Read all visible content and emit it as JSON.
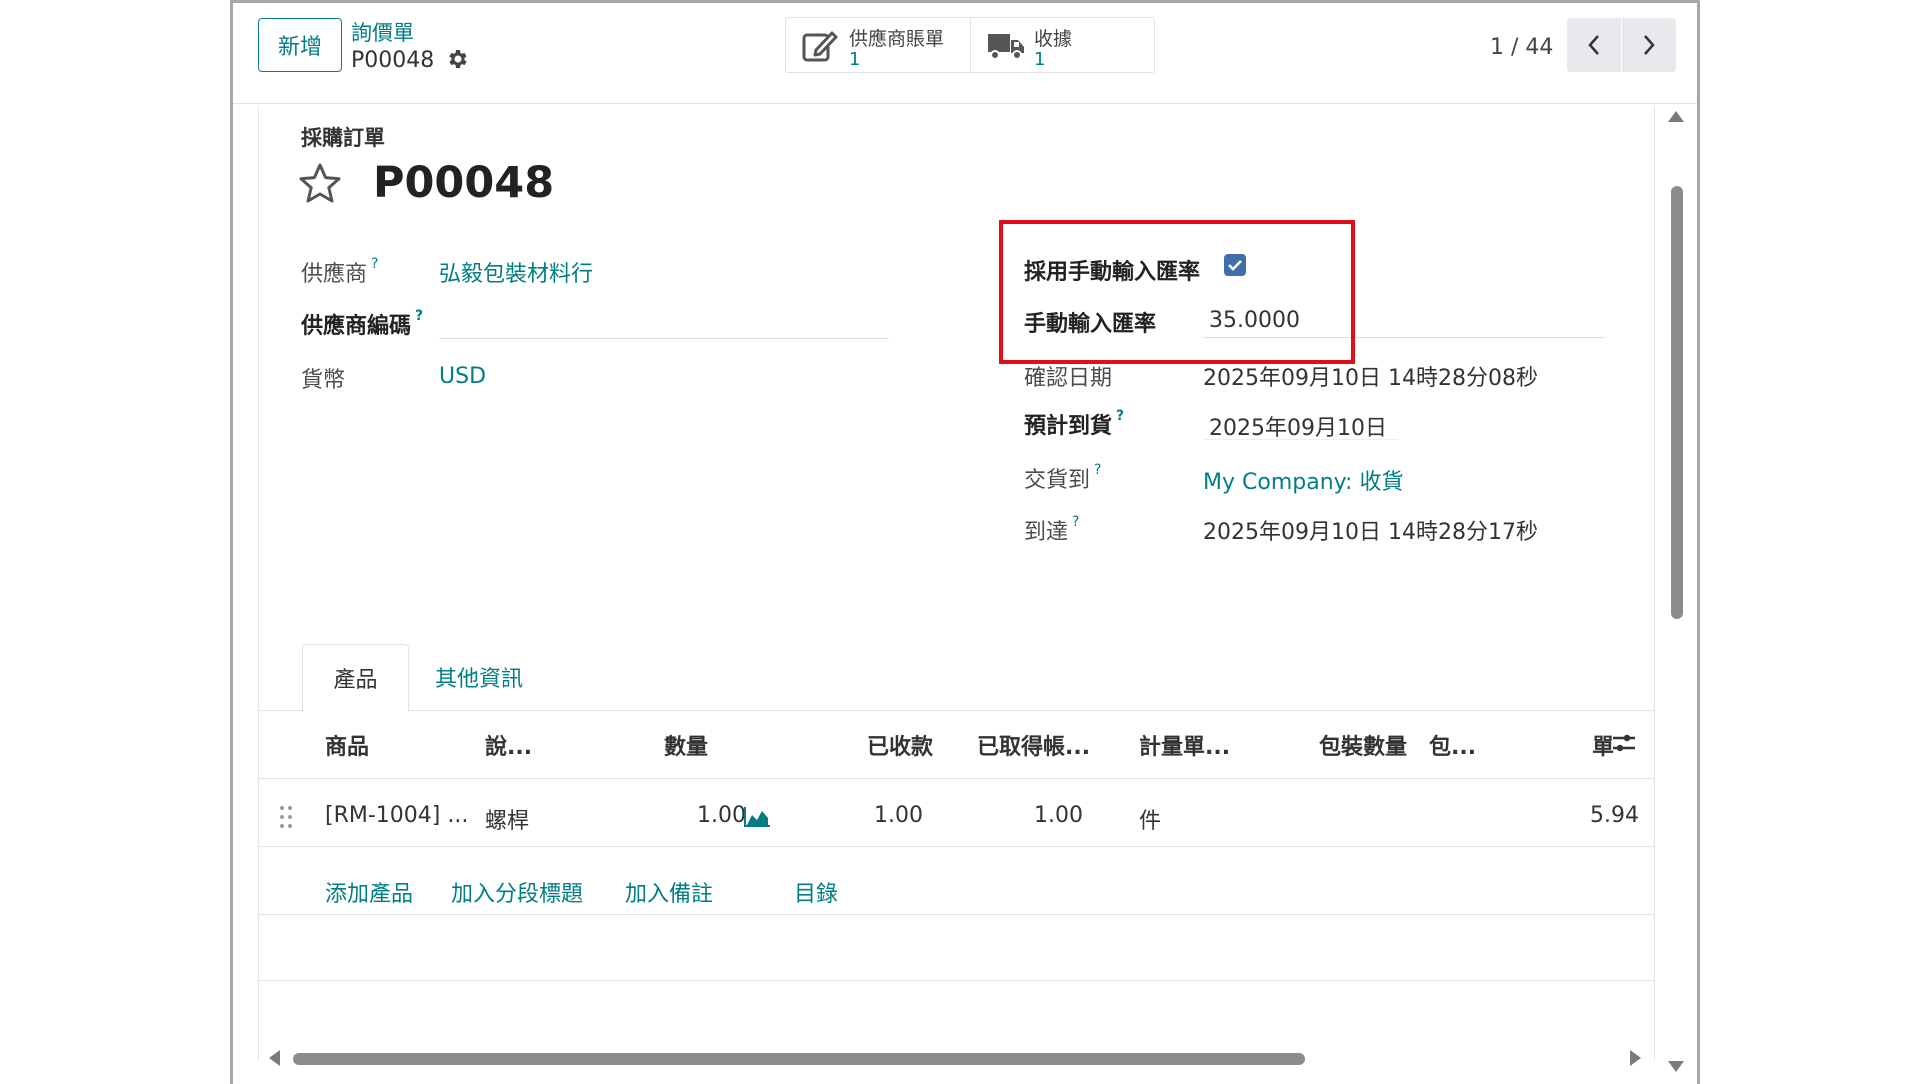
{
  "control_panel": {
    "new_button": "新增",
    "breadcrumb_parent": "詢價單",
    "breadcrumb_current": "P00048",
    "smart_buttons": [
      {
        "label": "供應商賬單",
        "value": "1",
        "icon": "edit-document-icon"
      },
      {
        "label": "收據",
        "value": "1",
        "icon": "truck-icon"
      }
    ],
    "pager": "1 / 44"
  },
  "sheet": {
    "record_type": "採購訂單",
    "title": "P00048",
    "fields_left": [
      {
        "label": "供應商",
        "value": "弘毅包裝材料行"
      },
      {
        "label": "供應商編碼",
        "value": ""
      },
      {
        "label": "貨幣",
        "value": "USD"
      }
    ],
    "fields_right": [
      {
        "label": "採用手動輸入匯率",
        "value": "checked"
      },
      {
        "label": "手動輸入匯率",
        "value": "35.0000"
      },
      {
        "label": "確認日期",
        "value": "2025年09月10日 14時28分08秒"
      },
      {
        "label": "預計到貨",
        "value": "2025年09月10日"
      },
      {
        "label": "交貨到",
        "value": "My Company: 收貨"
      },
      {
        "label": "到達",
        "value": "2025年09月10日 14時28分17秒"
      }
    ]
  },
  "tabs": [
    {
      "label": "產品",
      "active": true
    },
    {
      "label": "其他資訊",
      "active": false
    }
  ],
  "table": {
    "headers": [
      "商品",
      "說...",
      "數量",
      "已收款",
      "已取得帳...",
      "計量單...",
      "包裝數量",
      "包...",
      "單"
    ],
    "rows": [
      {
        "product": "[RM-1004] ...",
        "description": "螺桿",
        "quantity": "1.00",
        "received": "1.00",
        "billed": "1.00",
        "uom": "件",
        "price": "5.94"
      }
    ],
    "actions": [
      "添加產品",
      "加入分段標題",
      "加入備註",
      "目錄"
    ]
  },
  "colors": {
    "accent": "#017e84",
    "highlight": "#e0101a",
    "checkbox": "#3f6ea8"
  }
}
